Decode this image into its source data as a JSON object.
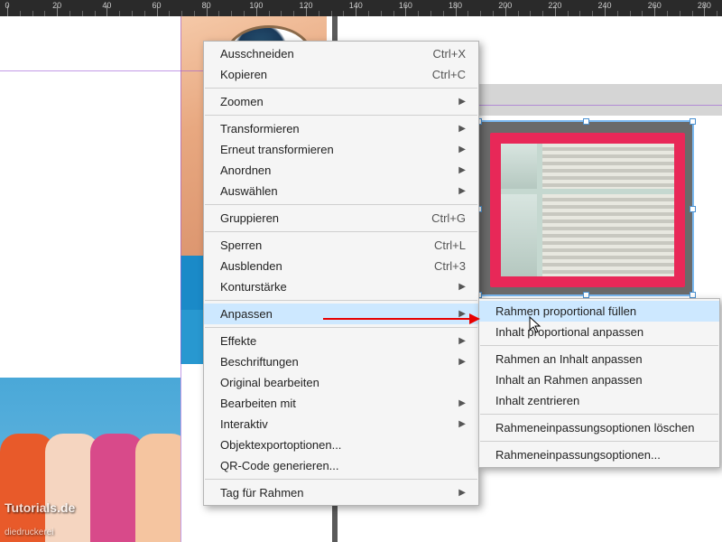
{
  "ruler": {
    "ticks": [
      0,
      20,
      40,
      60,
      80,
      100,
      120,
      140,
      160,
      180,
      200,
      220,
      240,
      260,
      280
    ]
  },
  "watermark": {
    "line1": "Tutorials.de",
    "line2": "diedruckerei"
  },
  "menu": {
    "cut": {
      "label": "Ausschneiden",
      "shortcut": "Ctrl+X"
    },
    "copy": {
      "label": "Kopieren",
      "shortcut": "Ctrl+C"
    },
    "zoom": {
      "label": "Zoomen"
    },
    "transform": {
      "label": "Transformieren"
    },
    "retransform": {
      "label": "Erneut transformieren"
    },
    "arrange": {
      "label": "Anordnen"
    },
    "select": {
      "label": "Auswählen"
    },
    "group": {
      "label": "Gruppieren",
      "shortcut": "Ctrl+G"
    },
    "lock": {
      "label": "Sperren",
      "shortcut": "Ctrl+L"
    },
    "hide": {
      "label": "Ausblenden",
      "shortcut": "Ctrl+3"
    },
    "stroke": {
      "label": "Konturstärke"
    },
    "fit": {
      "label": "Anpassen"
    },
    "effects": {
      "label": "Effekte"
    },
    "captions": {
      "label": "Beschriftungen"
    },
    "editorig": {
      "label": "Original bearbeiten"
    },
    "editwith": {
      "label": "Bearbeiten mit"
    },
    "interactive": {
      "label": "Interaktiv"
    },
    "objexport": {
      "label": "Objektexportoptionen..."
    },
    "qrcode": {
      "label": "QR-Code generieren..."
    },
    "tagframe": {
      "label": "Tag für Rahmen"
    }
  },
  "submenu": {
    "fillprop": {
      "label": "Rahmen proportional füllen"
    },
    "fitcontent": {
      "label": "Inhalt proportional anpassen"
    },
    "frametocontent": {
      "label": "Rahmen an Inhalt anpassen"
    },
    "contenttoframe": {
      "label": "Inhalt an Rahmen anpassen"
    },
    "center": {
      "label": "Inhalt zentrieren"
    },
    "clearopts": {
      "label": "Rahmeneinpassungsoptionen löschen"
    },
    "frameopts": {
      "label": "Rahmeneinpassungsoptionen..."
    }
  }
}
